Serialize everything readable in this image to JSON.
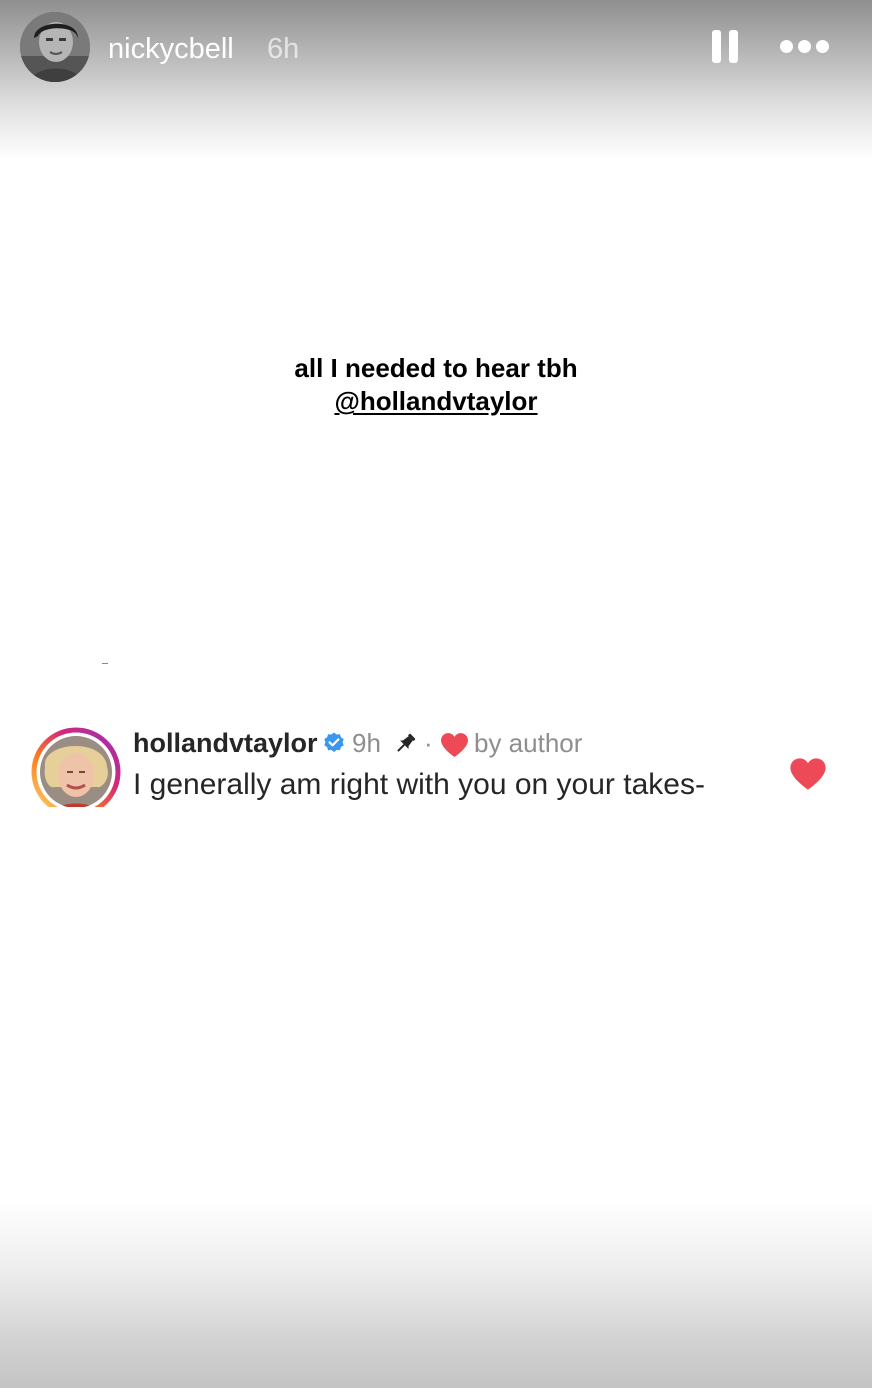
{
  "header": {
    "username": "nickycbell",
    "time": "6h"
  },
  "story": {
    "line1": "all I needed to hear tbh",
    "mention": "@hollandvtaylor"
  },
  "comment": {
    "username": "hollandvtaylor",
    "time": "9h",
    "separator": "·",
    "liked_by": "by author",
    "body": "I generally am right with you on your takes-"
  },
  "colors": {
    "heart_red": "#ed4956",
    "verified_blue": "#3897f0",
    "muted_text": "#8e8e8e",
    "text": "#262626"
  },
  "icons": {
    "pause": "pause-icon",
    "more": "more-options-icon",
    "verified": "verified-badge-icon",
    "pin": "pin-icon",
    "heart": "heart-icon"
  }
}
